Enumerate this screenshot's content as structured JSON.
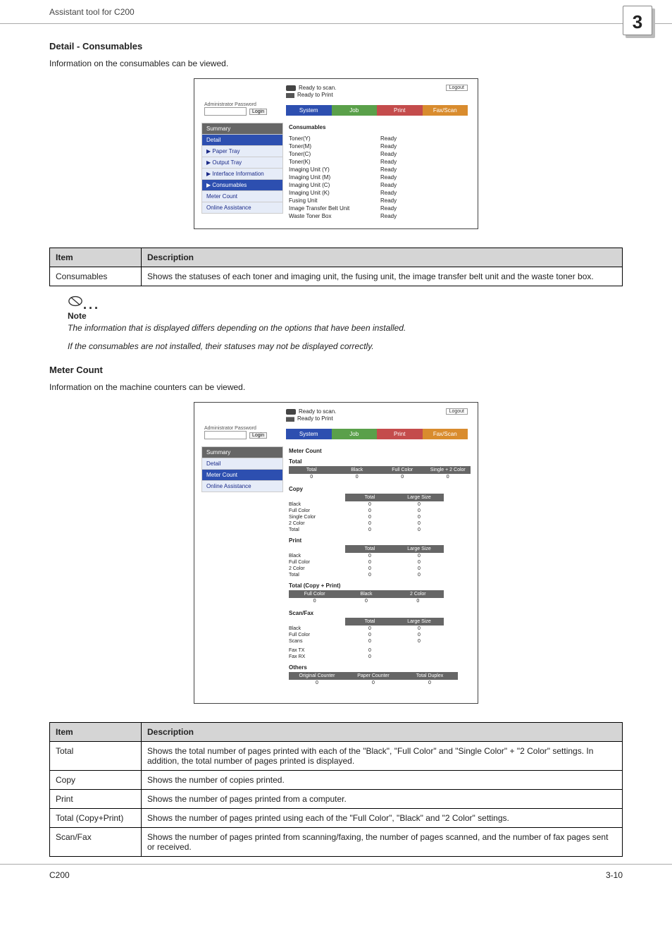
{
  "header": {
    "title": "Assistant tool for C200",
    "badge": "3"
  },
  "section1": {
    "heading": "Detail - Consumables",
    "intro": "Information on the consumables can be viewed."
  },
  "screenshot1": {
    "status1": "Ready to scan.",
    "status2": "Ready to Print",
    "logout": "Logout",
    "admin_label": "Administrator Password",
    "login": "Login",
    "tabs": {
      "system": "System",
      "job": "Job",
      "print": "Print",
      "faxscan": "Fax/Scan"
    },
    "nav": {
      "summary": "Summary",
      "detail": "Detail",
      "paper": "▶ Paper Tray",
      "output": "▶ Output Tray",
      "interface": "▶ Interface Information",
      "consumables": "▶ Consumables",
      "meter": "Meter Count",
      "online": "Online Assistance"
    },
    "main_title": "Consumables",
    "rows": [
      {
        "k": "Toner(Y)",
        "v": "Ready"
      },
      {
        "k": "Toner(M)",
        "v": "Ready"
      },
      {
        "k": "Toner(C)",
        "v": "Ready"
      },
      {
        "k": "Toner(K)",
        "v": "Ready"
      },
      {
        "k": "Imaging Unit (Y)",
        "v": "Ready"
      },
      {
        "k": "Imaging Unit (M)",
        "v": "Ready"
      },
      {
        "k": "Imaging Unit (C)",
        "v": "Ready"
      },
      {
        "k": "Imaging Unit (K)",
        "v": "Ready"
      },
      {
        "k": "Fusing Unit",
        "v": "Ready"
      },
      {
        "k": "Image Transfer Belt Unit",
        "v": "Ready"
      },
      {
        "k": "Waste Toner Box",
        "v": "Ready"
      }
    ]
  },
  "table1": {
    "head_item": "Item",
    "head_desc": "Description",
    "rows": [
      {
        "item": "Consumables",
        "desc": "Shows the statuses of each toner and imaging unit, the fusing unit, the image transfer belt unit and the waste toner box."
      }
    ]
  },
  "note": {
    "title": "Note",
    "p1": "The information that is displayed differs depending on the options that have been installed.",
    "p2": "If the consumables are not installed, their statuses may not be displayed correctly."
  },
  "section2": {
    "heading": "Meter Count",
    "intro": "Information on the machine counters can be viewed."
  },
  "screenshot2": {
    "main_title": "Meter Count",
    "nav_sel": "Meter Count",
    "total_label": "Total",
    "total_head": [
      "Total",
      "Black",
      "Full Color",
      "Single + 2 Color"
    ],
    "total_vals": [
      "0",
      "0",
      "0",
      "0"
    ],
    "copy_label": "Copy",
    "cp_head": [
      "Total",
      "Large Size"
    ],
    "cp_rows": [
      {
        "lbl": "Black",
        "a": "0",
        "b": "0"
      },
      {
        "lbl": "Full Color",
        "a": "0",
        "b": "0"
      },
      {
        "lbl": "Single Color",
        "a": "0",
        "b": "0"
      },
      {
        "lbl": "2 Color",
        "a": "0",
        "b": "0"
      },
      {
        "lbl": "Total",
        "a": "0",
        "b": "0"
      }
    ],
    "print_label": "Print",
    "pr_rows": [
      {
        "lbl": "Black",
        "a": "0",
        "b": "0"
      },
      {
        "lbl": "Full Color",
        "a": "0",
        "b": "0"
      },
      {
        "lbl": "2 Color",
        "a": "0",
        "b": "0"
      },
      {
        "lbl": "Total",
        "a": "0",
        "b": "0"
      }
    ],
    "tcp_label": "Total (Copy + Print)",
    "tcp_head": [
      "Full Color",
      "Black",
      "2 Color"
    ],
    "tcp_vals": [
      "0",
      "0",
      "0"
    ],
    "sf_label": "Scan/Fax",
    "sf_rows": [
      {
        "lbl": "Black",
        "a": "0",
        "b": "0"
      },
      {
        "lbl": "Full Color",
        "a": "0",
        "b": "0"
      },
      {
        "lbl": "Scans",
        "a": "0",
        "b": "0"
      }
    ],
    "fax_tx": {
      "lbl": "Fax TX",
      "v": "0"
    },
    "fax_rx": {
      "lbl": "Fax RX",
      "v": "0"
    },
    "others_label": "Others",
    "others_head": [
      "Original Counter",
      "Paper Counter",
      "Total Duplex"
    ],
    "others_vals": [
      "0",
      "0",
      "0"
    ]
  },
  "table2": {
    "head_item": "Item",
    "head_desc": "Description",
    "rows": [
      {
        "item": "Total",
        "desc": "Shows the total number of pages printed with each of the \"Black\", \"Full Color\" and \"Single Color\" + \"2 Color\" settings. In addition, the total number of pages printed is displayed."
      },
      {
        "item": "Copy",
        "desc": "Shows the number of copies printed."
      },
      {
        "item": "Print",
        "desc": "Shows the number of pages printed from a computer."
      },
      {
        "item": "Total (Copy+Print)",
        "desc": "Shows the number of pages printed using each of the \"Full Color\", \"Black\" and \"2 Color\" settings."
      },
      {
        "item": "Scan/Fax",
        "desc": "Shows the number of pages printed from scanning/faxing, the number of pages scanned, and the number of fax pages sent or received."
      }
    ]
  },
  "footer": {
    "left": "C200",
    "right": "3-10"
  }
}
